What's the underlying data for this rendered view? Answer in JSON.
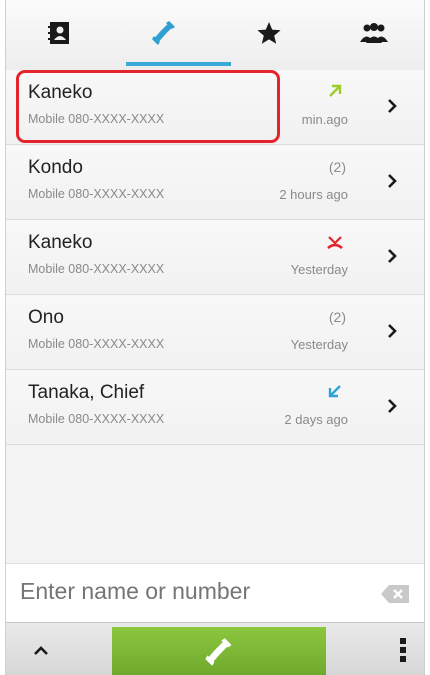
{
  "tabs": [
    {
      "icon": "contacts-icon"
    },
    {
      "icon": "phone-log-icon",
      "selected": true
    },
    {
      "icon": "star-icon"
    },
    {
      "icon": "groups-icon"
    }
  ],
  "calls": [
    {
      "name": "Kaneko",
      "number": "Mobile 080-XXXX-XXXX",
      "count": "",
      "time": "min.ago",
      "type": "outgoing",
      "type_color": "#9ccc2b"
    },
    {
      "name": "Kondo",
      "number": "Mobile 080-XXXX-XXXX",
      "count": "(2)",
      "time": "2 hours ago",
      "type": "",
      "type_color": ""
    },
    {
      "name": "Kaneko",
      "number": "Mobile 080-XXXX-XXXX",
      "count": "",
      "time": "Yesterday",
      "type": "missed",
      "type_color": "#e3242b"
    },
    {
      "name": "Ono",
      "number": "Mobile 080-XXXX-XXXX",
      "count": "(2)",
      "time": "Yesterday",
      "type": "",
      "type_color": ""
    },
    {
      "name": "Tanaka, Chief",
      "number": "Mobile 080-XXXX-XXXX",
      "count": "",
      "time": "2 days ago",
      "type": "incoming",
      "type_color": "#2ea3d8"
    }
  ],
  "dial": {
    "placeholder": "Enter name or number",
    "value": ""
  },
  "colors": {
    "accent": "#39a9d8",
    "call_button": "#7cb832",
    "highlight": "#e3242b"
  }
}
